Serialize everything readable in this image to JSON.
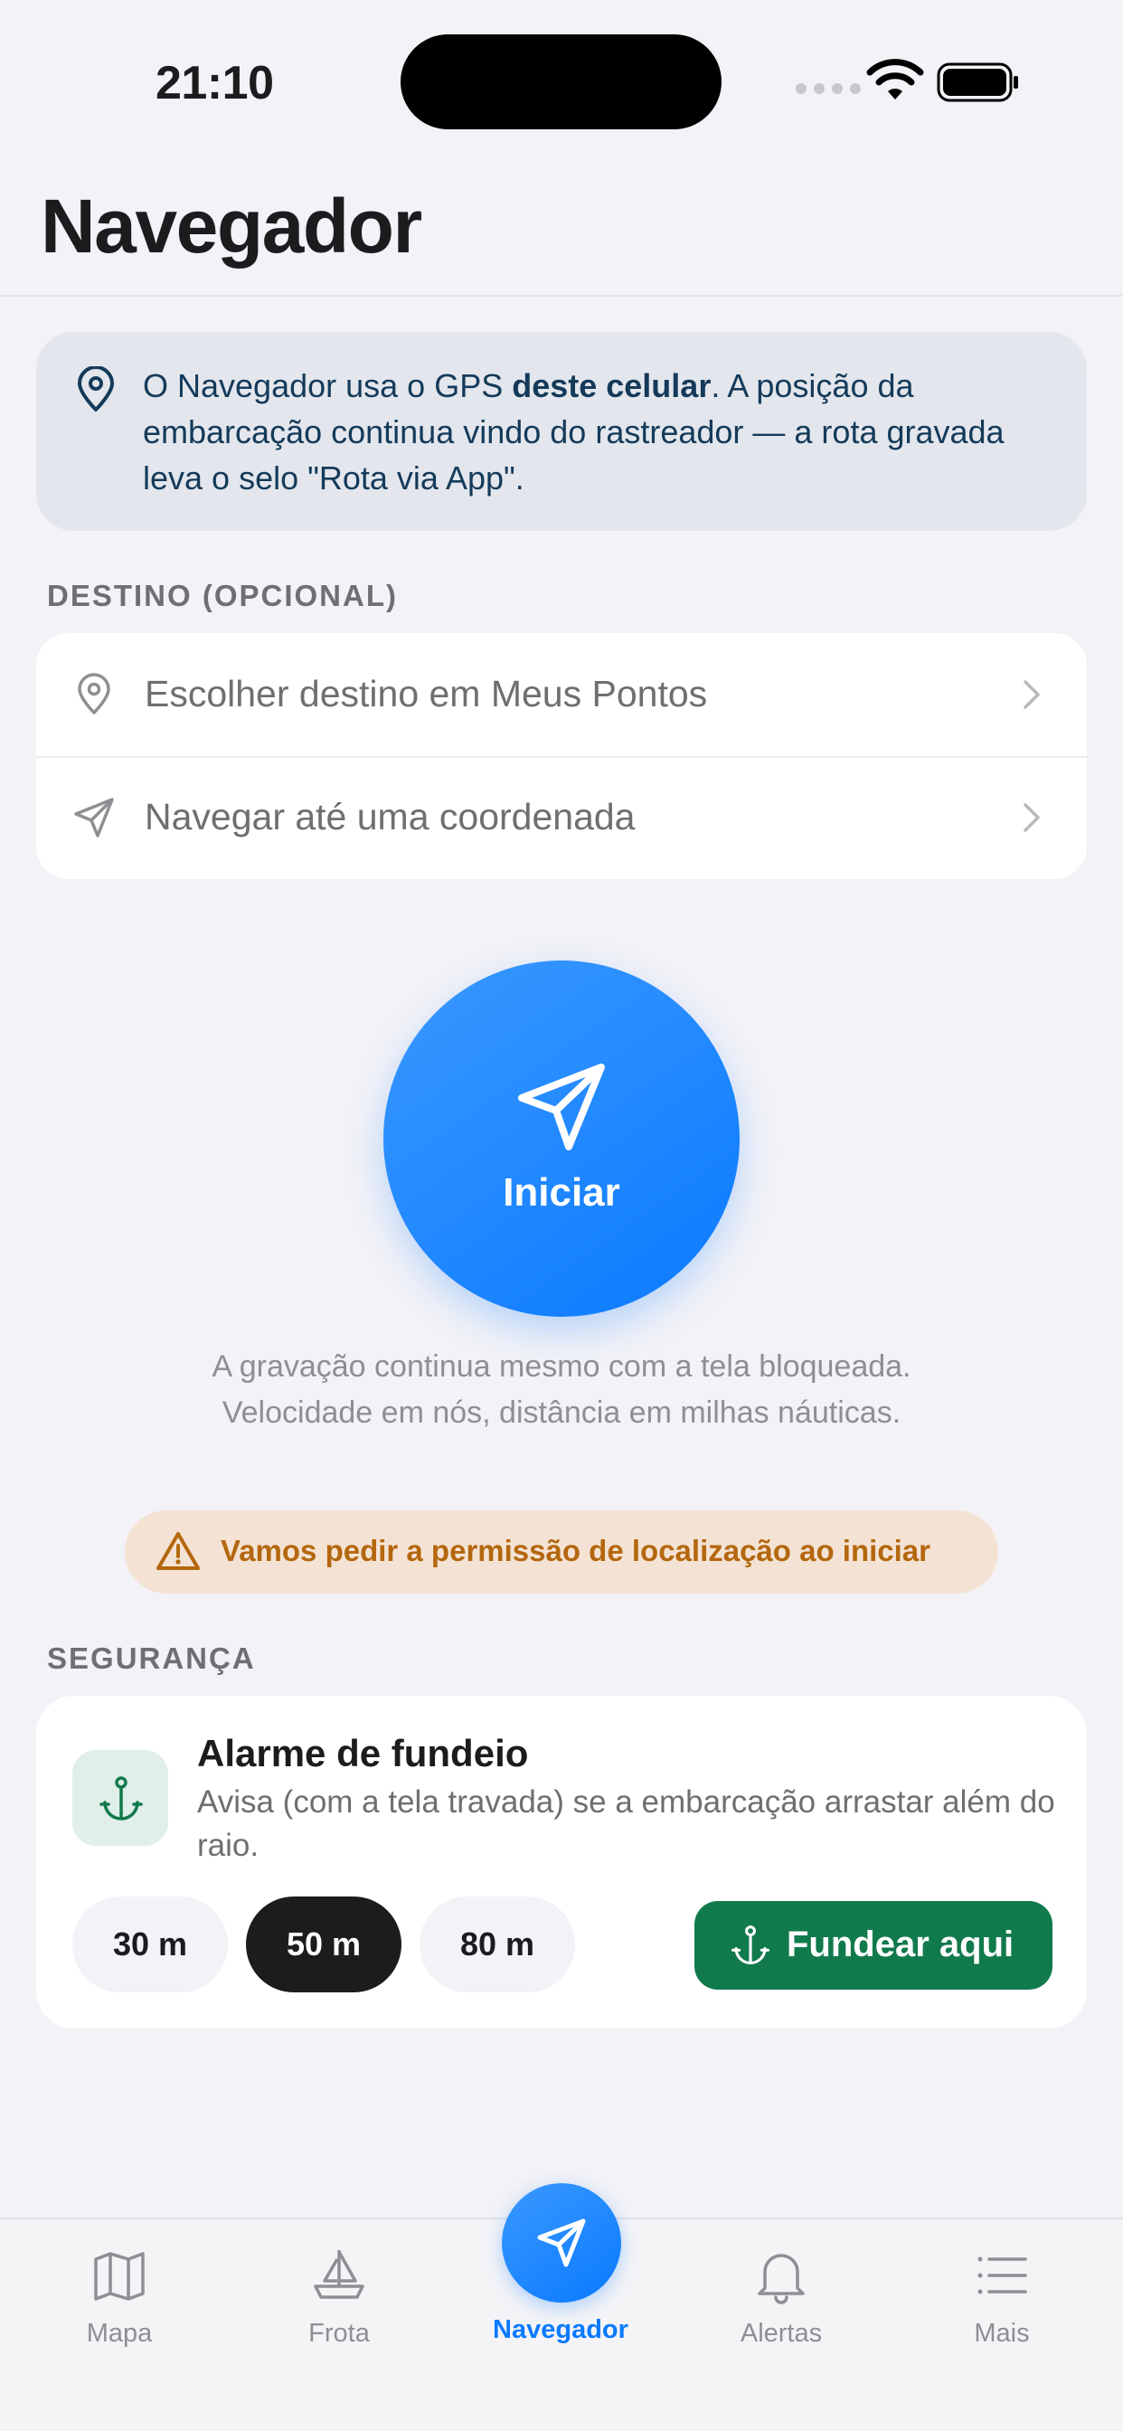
{
  "status_bar": {
    "time": "21:10"
  },
  "header": {
    "title": "Navegador"
  },
  "info_card": {
    "text_before": "O Navegador usa o GPS ",
    "text_bold": "deste celular",
    "text_after": ". A posição da embarcação continua vindo do rastreador — a rota gravada leva o selo \"Rota via App\"."
  },
  "destination": {
    "section_label": "DESTINO (OPCIONAL)",
    "rows": [
      {
        "label": "Escolher destino em Meus Pontos",
        "icon": "map-pin-icon"
      },
      {
        "label": "Navegar até uma coordenada",
        "icon": "navigation-arrow-icon"
      }
    ]
  },
  "start": {
    "label": "Iniciar",
    "note": "A gravação continua mesmo com a tela bloqueada. Velocidade em nós, distância em milhas náuticas."
  },
  "permission": {
    "text": "Vamos pedir a permissão de localização ao iniciar"
  },
  "safety": {
    "section_label": "SEGURANÇA",
    "title": "Alarme de fundeio",
    "description": "Avisa (com a tela travada) se a embarcação arrastar além do raio.",
    "radius_options": [
      "30 m",
      "50 m",
      "80 m"
    ],
    "selected_radius": "50 m",
    "anchor_button": "Fundear aqui"
  },
  "tab_bar": {
    "tabs": [
      {
        "label": "Mapa",
        "icon": "map-icon"
      },
      {
        "label": "Frota",
        "icon": "sailboat-icon"
      },
      {
        "label": "Navegador",
        "icon": "navigation-arrow-icon"
      },
      {
        "label": "Alertas",
        "icon": "bell-icon"
      },
      {
        "label": "Mais",
        "icon": "list-icon"
      }
    ],
    "active": "Navegador"
  },
  "colors": {
    "accent": "#0A7AFF",
    "info_bg": "#E3E6EC",
    "info_text": "#143A5A",
    "warning_bg": "#F4E3D4",
    "warning_text": "#B4670E",
    "anchor_green": "#117A4C",
    "page_bg": "#F2F2F7"
  }
}
